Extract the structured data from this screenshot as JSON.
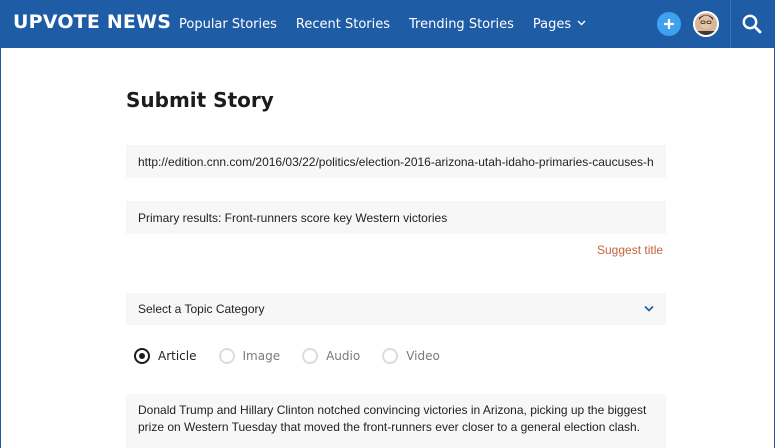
{
  "header": {
    "brand": "UPVOTE NEWS",
    "nav": [
      "Popular Stories",
      "Recent Stories",
      "Trending Stories",
      "Pages"
    ],
    "pages_chevron_icon": "chevron-down-icon",
    "add_icon": "plus-icon",
    "search_icon": "search-icon",
    "colors": {
      "bar": "#1f5ca6",
      "add_button": "#3ea2ee"
    }
  },
  "form": {
    "title": "Submit Story",
    "url_value": "http://edition.cnn.com/2016/03/22/politics/election-2016-arizona-utah-idaho-primaries-caucuses-h",
    "title_value": "Primary results: Front-runners score key Western victories",
    "suggest_label": "Suggest title",
    "category_placeholder": "Select a Topic Category",
    "post_types": [
      {
        "label": "Article",
        "checked": true
      },
      {
        "label": "Image",
        "checked": false
      },
      {
        "label": "Audio",
        "checked": false
      },
      {
        "label": "Video",
        "checked": false
      }
    ],
    "description": "Donald Trump and Hillary Clinton notched convincing victories in Arizona, picking up the biggest prize on Western Tuesday that moved the front-runners ever closer to a general election clash.",
    "colors": {
      "suggest": "#c5623b",
      "field_bg": "#f7f7f7"
    }
  }
}
